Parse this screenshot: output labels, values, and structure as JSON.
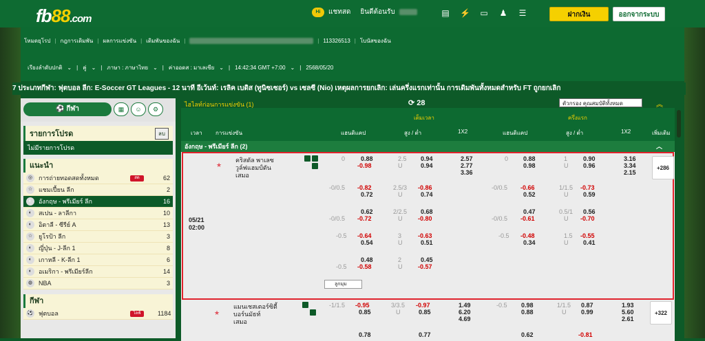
{
  "brand": {
    "logo_a": "fb",
    "logo_b": "88",
    "logo_c": ".com"
  },
  "topbar": {
    "chat": "แชทสด",
    "welcome": "ยินดีต้อนรับ",
    "deposit": "ฝากเงิน",
    "logout": "ออกจากระบบ"
  },
  "nav": {
    "links": [
      "โหมดยุโรป",
      "กฎการเดิมพัน",
      "ผลการแข่งขัน",
      "เดิมพันของฉัน"
    ],
    "account": "113326513",
    "announce": "โบนัสของฉัน",
    "sort": "เรียงลำดับปกติ",
    "pair": "คู่",
    "lang": "ภาษา : ภาษาไทย",
    "odds": "ค่าออดส : มาเลเซีย",
    "time": "14:42:34 GMT +7:00",
    "date": "2568/05/20"
  },
  "ticker": "7 ประเภทกีฬา: ฟุตบอล ลีก: E-Soccer GT Leagues - 12 นาที อีเว้นท์: เรลิค เบดิส (ทูนิซเซอร์) vs เซลซี (Nio) เหตุผลการยกเลิก: เล่นครึ่งแรกเท่านั้น การเดิมพันทั้งหมดสำหรับ FT ถูกยกเลิก",
  "sidebar": {
    "sport_btn": "กีฬา",
    "fav_title": "รายการโปรด",
    "fav_delete": "ลบ",
    "no_fav": "ไม่มีรายการโปรด",
    "rec_title": "แนะนำ",
    "leagues": [
      {
        "name": "การถ่ายทอดสดทั้งหมด",
        "count": "62",
        "live": "สด"
      },
      {
        "name": "แชมเปี้ยน ลีก",
        "count": "2"
      },
      {
        "name": "อังกฤษ - พรีเมียร์ ลีก",
        "count": "16"
      },
      {
        "name": "สเปน - ลาลีกา",
        "count": "10"
      },
      {
        "name": "อิตาลี - ซีรีย์ A",
        "count": "13"
      },
      {
        "name": "ยูโรป้า ลีก",
        "count": "3"
      },
      {
        "name": "ญี่ปุ่น - J-ลีก 1",
        "count": "8"
      },
      {
        "name": "เกาหลี - K-ลีก 1",
        "count": "6"
      },
      {
        "name": "อเมริกา - พรีเมียร์ลีก",
        "count": "14"
      },
      {
        "name": "NBA",
        "count": "3"
      }
    ],
    "sport_title": "กีฬา",
    "football": "ฟุตบอล",
    "football_live": "ไลฟ์",
    "football_count": "1184"
  },
  "main": {
    "title": "ไฮไลท์ก่อนการแข่งขัน (1)",
    "count": "28",
    "filter": "ตัวกรอง คุณสมบัติทั้งหมด",
    "col_time": "เวลา",
    "col_event": "การแข่งขัน",
    "col_full": "เต็มเวลา",
    "col_half": "ครึ่งแรก",
    "col_hdp": "แฮนดิแคป",
    "col_ou": "สูง / ต่ำ",
    "col_1x2": "1X2",
    "col_more": "เพิ่มเติม",
    "league": "อังกฤษ - พรีเมียร์ ลีก (2)",
    "match1": {
      "date": "05/21",
      "time": "02:00",
      "home": "คริสตัล พาเลซ",
      "away": "วูล์ฟแฮมป์ตัน",
      "draw": "เสมอ",
      "more": "+286",
      "show_more": "ลูกมุม"
    },
    "match2": {
      "home": "แมนเชสเตอร์ซิตี้",
      "away": "บอร์นมัธท์",
      "draw": "เสมอ",
      "more": "+322"
    }
  }
}
